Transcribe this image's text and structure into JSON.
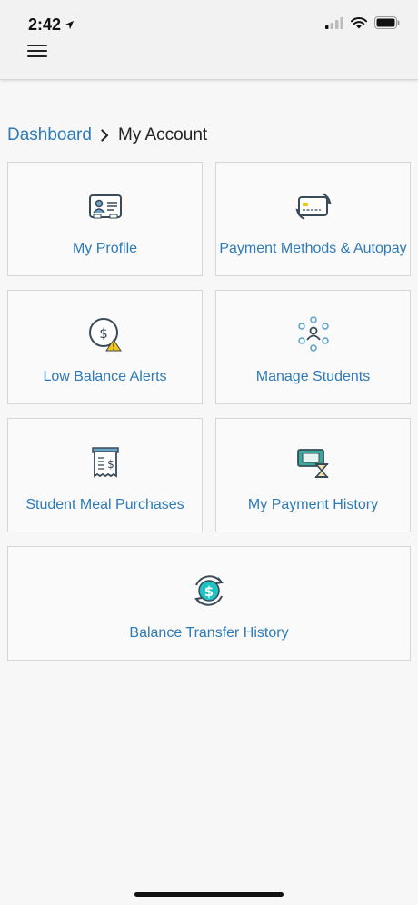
{
  "status_bar": {
    "time": "2:42"
  },
  "breadcrumb": {
    "parent": "Dashboard",
    "current": "My Account"
  },
  "tiles": [
    {
      "label": "My Profile",
      "icon": "id-card-icon"
    },
    {
      "label": "Payment Methods & Autopay",
      "icon": "credit-card-icon"
    },
    {
      "label": "Low Balance Alerts",
      "icon": "low-balance-alert-icon"
    },
    {
      "label": "Manage Students",
      "icon": "people-network-icon"
    },
    {
      "label": "Student Meal Purchases",
      "icon": "receipt-icon"
    },
    {
      "label": "My Payment History",
      "icon": "payment-history-icon"
    },
    {
      "label": "Balance Transfer History",
      "icon": "dollar-transfer-icon"
    }
  ],
  "colors": {
    "link": "#2e7ab8",
    "accent_teal": "#1ec3c3",
    "warning": "#f5c518"
  }
}
